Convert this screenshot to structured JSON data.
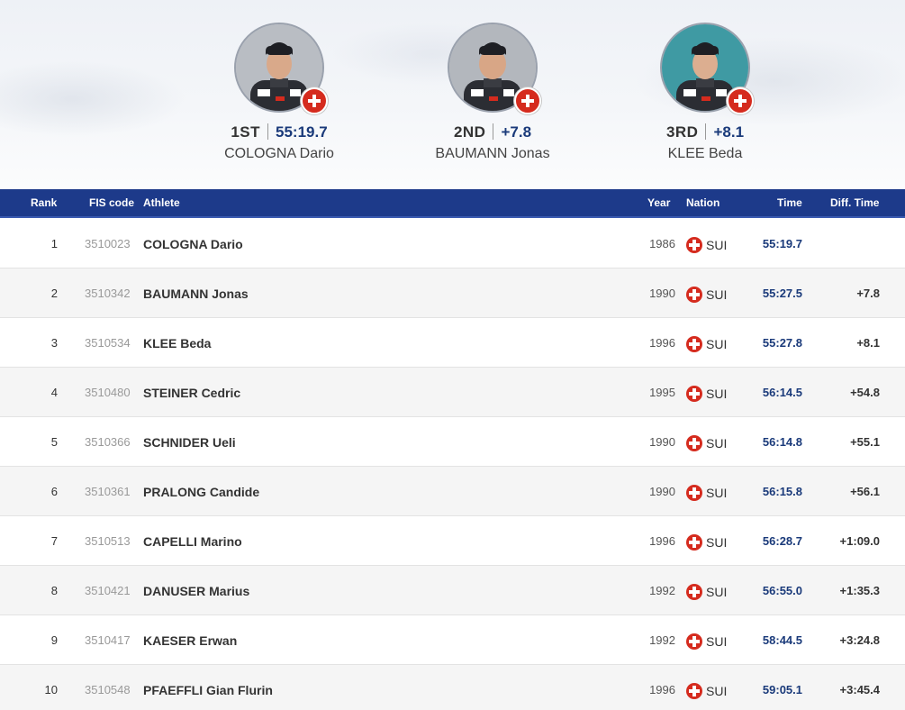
{
  "podium": [
    {
      "rank": "1ST",
      "value": "55:19.7",
      "name": "COLOGNA Dario",
      "bg": "#b9bdc3",
      "flag_icon": "swiss-flag-icon"
    },
    {
      "rank": "2ND",
      "value": "+7.8",
      "name": "BAUMANN Jonas",
      "bg": "#b3b7bd",
      "flag_icon": "swiss-flag-icon"
    },
    {
      "rank": "3RD",
      "value": "+8.1",
      "name": "KLEE Beda",
      "bg": "#3f9aa3",
      "flag_icon": "swiss-flag-icon"
    }
  ],
  "table": {
    "headers": {
      "rank": "Rank",
      "fis": "FIS code",
      "athlete": "Athlete",
      "year": "Year",
      "nation": "Nation",
      "time": "Time",
      "diff": "Diff. Time"
    },
    "rows": [
      {
        "rank": "1",
        "fis": "3510023",
        "athlete": "COLOGNA Dario",
        "year": "1986",
        "nation": "SUI",
        "time": "55:19.7",
        "diff": ""
      },
      {
        "rank": "2",
        "fis": "3510342",
        "athlete": "BAUMANN Jonas",
        "year": "1990",
        "nation": "SUI",
        "time": "55:27.5",
        "diff": "+7.8"
      },
      {
        "rank": "3",
        "fis": "3510534",
        "athlete": "KLEE Beda",
        "year": "1996",
        "nation": "SUI",
        "time": "55:27.8",
        "diff": "+8.1"
      },
      {
        "rank": "4",
        "fis": "3510480",
        "athlete": "STEINER Cedric",
        "year": "1995",
        "nation": "SUI",
        "time": "56:14.5",
        "diff": "+54.8"
      },
      {
        "rank": "5",
        "fis": "3510366",
        "athlete": "SCHNIDER Ueli",
        "year": "1990",
        "nation": "SUI",
        "time": "56:14.8",
        "diff": "+55.1"
      },
      {
        "rank": "6",
        "fis": "3510361",
        "athlete": "PRALONG Candide",
        "year": "1990",
        "nation": "SUI",
        "time": "56:15.8",
        "diff": "+56.1"
      },
      {
        "rank": "7",
        "fis": "3510513",
        "athlete": "CAPELLI Marino",
        "year": "1996",
        "nation": "SUI",
        "time": "56:28.7",
        "diff": "+1:09.0"
      },
      {
        "rank": "8",
        "fis": "3510421",
        "athlete": "DANUSER Marius",
        "year": "1992",
        "nation": "SUI",
        "time": "56:55.0",
        "diff": "+1:35.3"
      },
      {
        "rank": "9",
        "fis": "3510417",
        "athlete": "KAESER Erwan",
        "year": "1992",
        "nation": "SUI",
        "time": "58:44.5",
        "diff": "+3:24.8"
      },
      {
        "rank": "10",
        "fis": "3510548",
        "athlete": "PFAEFFLI Gian Flurin",
        "year": "1996",
        "nation": "SUI",
        "time": "59:05.1",
        "diff": "+3:45.4"
      }
    ]
  },
  "colors": {
    "header_bg": "#1d3a8a",
    "time_text": "#1a3a7a",
    "alt_row": "#f5f5f5",
    "swiss_red": "#d52b1e"
  }
}
